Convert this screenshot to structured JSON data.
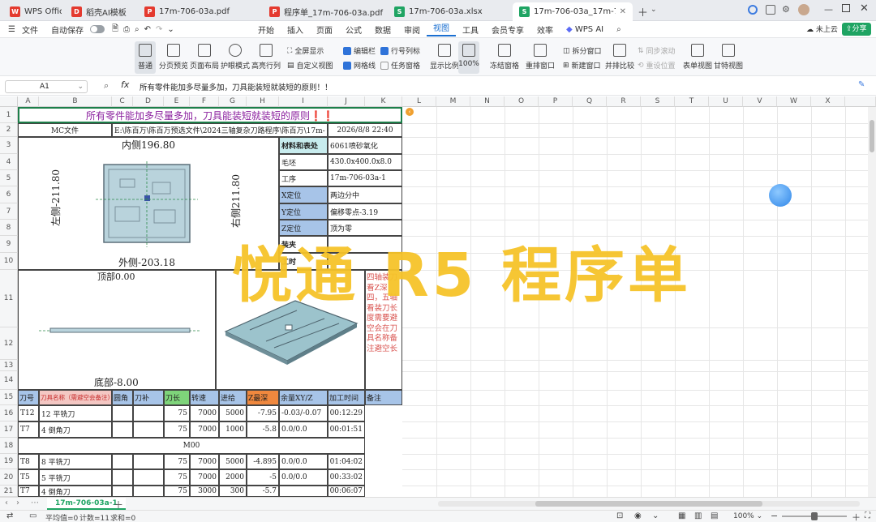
{
  "tabs": [
    {
      "label": "WPS Office",
      "icon": "W",
      "color": "#e43a2f"
    },
    {
      "label": "稻壳AI模板",
      "icon": "D",
      "color": "#e43a2f"
    },
    {
      "label": "17m-706-03a.pdf",
      "icon": "P",
      "color": "#e43a2f"
    },
    {
      "label": "程序单_17m-706-03a.pdf",
      "icon": "P",
      "color": "#e43a2f"
    },
    {
      "label": "17m-706-03a.xlsx",
      "icon": "S",
      "color": "#1fa463"
    },
    {
      "label": "17m-706-03a_17m-706-0",
      "icon": "S",
      "color": "#1fa463"
    }
  ],
  "menubar": {
    "file": "文件",
    "autosave": "自动保存",
    "items": [
      "开始",
      "插入",
      "页面",
      "公式",
      "数据",
      "审阅",
      "视图",
      "工具",
      "会员专享",
      "效率",
      "WPS AI"
    ],
    "active": "视图",
    "cloud": "未上云",
    "share": "分享"
  },
  "ribbon": {
    "normal": "普通",
    "page_break": "分页预览",
    "page_layout": "页面布局",
    "eye_mode": "护眼模式",
    "highlight": "高亮行列",
    "fullscreen": "全屏显示",
    "custom_view": "自定义视图",
    "formula_bar": "编辑栏",
    "gridlines": "网格线",
    "headings": "行号列标",
    "task_pane": "任务窗格",
    "zoom_ratio": "显示比例",
    "zoom_100": "100%",
    "freeze": "冻结窗格",
    "arrange": "重排窗口",
    "split": "拆分窗口",
    "new_window": "新建窗口",
    "side_by_side": "并排比较",
    "sync_scroll": "同步滚动",
    "reset_pos": "重设位置",
    "form_view": "表单视图",
    "gantt_view": "甘特视图"
  },
  "formula_bar": {
    "name_box": "A1",
    "content": "所有零件能加多尽量多加，刀具能装短就装短的原则！！"
  },
  "columns": [
    "A",
    "B",
    "C",
    "D",
    "E",
    "F",
    "G",
    "H",
    "I",
    "J",
    "K",
    "L",
    "M",
    "N",
    "O",
    "P",
    "Q",
    "R",
    "S",
    "T",
    "U",
    "V",
    "W",
    "X"
  ],
  "rows": [
    "1",
    "2",
    "3",
    "4",
    "5",
    "6",
    "7",
    "8",
    "9",
    "10",
    "11",
    "12",
    "13",
    "14",
    "15",
    "16",
    "17",
    "18",
    "19",
    "20",
    "21"
  ],
  "sheet": {
    "title": "所有零件能加多尽量多加，刀具能装短就装短的原则❗❗",
    "mc_label": "MC文件",
    "mc_path": "E:\\陈百万\\陈百万预选文件\\2024三轴复杂刀路程序\\陈百万\\17m-",
    "date": "2026/8/8  22:40",
    "inner": "内侧196.80",
    "left": "左侧-211.80",
    "right": "右侧211.80",
    "outer": "外侧-203.18",
    "top": "顶部0.00",
    "bottom": "底部-8.00",
    "info": [
      {
        "k": "材料和表处",
        "v": "6061喷砂氧化"
      },
      {
        "k": "毛坯",
        "v": "430.0x400.0x8.0"
      },
      {
        "k": "工序",
        "v": "17m-706-03a-1"
      },
      {
        "k": "X定位",
        "v": "两边分中"
      },
      {
        "k": "Y定位",
        "v": "偏移零点-3.19"
      },
      {
        "k": "Z定位",
        "v": "顶为零"
      },
      {
        "k": "装夹",
        "v": ""
      },
      {
        "k": "工时",
        "v": ""
      }
    ],
    "note": "四轴装刀看Z深四，五轴看装刀长度需要避空会在刀具名称备注避空长",
    "headers": [
      "刀号",
      "刀具名称（需避空会备注）",
      "圆角",
      "刀补",
      "刀长",
      "转速",
      "进给",
      "Z最深",
      "余量XY/Z",
      "加工时间",
      "备注"
    ],
    "tools": [
      {
        "no": "T12",
        "name": "12 平铣刀",
        "len": "75",
        "speed": "7000",
        "feed": "5000",
        "z": "-7.95",
        "allow": "-0.03/-0.07",
        "time": "00:12:29"
      },
      {
        "no": "T7",
        "name": "4 倒角刀",
        "len": "75",
        "speed": "7000",
        "feed": "1000",
        "z": "-5.8",
        "allow": "0.0/0.0",
        "time": "00:01:51"
      },
      {
        "no": "",
        "name": "M00",
        "len": "",
        "speed": "",
        "feed": "",
        "z": "",
        "allow": "",
        "time": ""
      },
      {
        "no": "T8",
        "name": "8 平铣刀",
        "len": "75",
        "speed": "7000",
        "feed": "5000",
        "z": "-4.895",
        "allow": "0.0/0.0",
        "time": "01:04:02"
      },
      {
        "no": "T5",
        "name": "5 平铣刀",
        "len": "75",
        "speed": "7000",
        "feed": "2000",
        "z": "-5",
        "allow": "0.0/0.0",
        "time": "00:33:02"
      },
      {
        "no": "T7",
        "name": "4 倒角刀",
        "len": "75",
        "speed": "3000",
        "feed": "300",
        "z": "-5.7",
        "allow": "",
        "time": "00:06:07"
      }
    ]
  },
  "watermark": "悦通 R5 程序单",
  "sheet_tab": "17m-706-03a-1",
  "status": {
    "avg": "平均值=0",
    "count": "计数=11",
    "sum": "求和=0",
    "zoom": "100%"
  }
}
